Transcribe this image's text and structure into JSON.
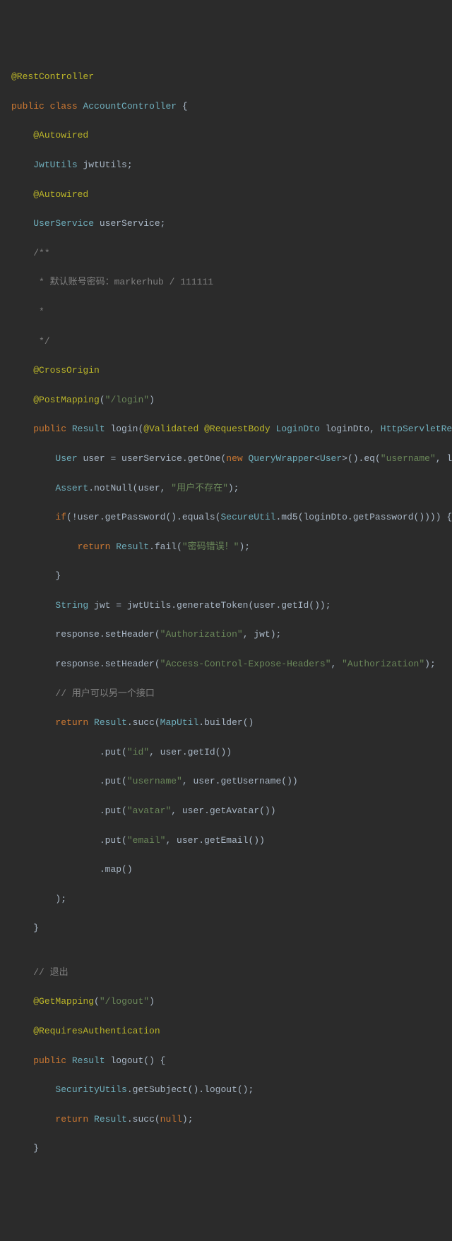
{
  "lines": [
    {
      "indent": 0,
      "tokens": [
        {
          "t": "@RestController",
          "c": "annotation"
        }
      ]
    },
    {
      "indent": 0,
      "tokens": []
    },
    {
      "indent": 0,
      "tokens": [
        {
          "t": "public",
          "c": "keyword"
        },
        {
          "t": " ",
          "c": "plain"
        },
        {
          "t": "class",
          "c": "keyword"
        },
        {
          "t": " ",
          "c": "plain"
        },
        {
          "t": "AccountController",
          "c": "type2"
        },
        {
          "t": " {",
          "c": "punct"
        }
      ]
    },
    {
      "indent": 0,
      "tokens": []
    },
    {
      "indent": 1,
      "tokens": [
        {
          "t": "@Autowired",
          "c": "annotation"
        }
      ]
    },
    {
      "indent": 0,
      "tokens": []
    },
    {
      "indent": 1,
      "tokens": [
        {
          "t": "JwtUtils",
          "c": "type2"
        },
        {
          "t": " jwtUtils;",
          "c": "plain"
        }
      ]
    },
    {
      "indent": 0,
      "tokens": []
    },
    {
      "indent": 1,
      "tokens": [
        {
          "t": "@Autowired",
          "c": "annotation"
        }
      ]
    },
    {
      "indent": 0,
      "tokens": []
    },
    {
      "indent": 1,
      "tokens": [
        {
          "t": "UserService",
          "c": "type2"
        },
        {
          "t": " userService;",
          "c": "plain"
        }
      ]
    },
    {
      "indent": 0,
      "tokens": []
    },
    {
      "indent": 1,
      "tokens": [
        {
          "t": "/**",
          "c": "comment"
        }
      ]
    },
    {
      "indent": 0,
      "tokens": []
    },
    {
      "indent": 1,
      "tokens": [
        {
          "t": " * 默认账号密码：markerhub / 111111",
          "c": "comment"
        }
      ]
    },
    {
      "indent": 0,
      "tokens": []
    },
    {
      "indent": 1,
      "tokens": [
        {
          "t": " *",
          "c": "comment"
        }
      ]
    },
    {
      "indent": 0,
      "tokens": []
    },
    {
      "indent": 1,
      "tokens": [
        {
          "t": " */",
          "c": "comment"
        }
      ]
    },
    {
      "indent": 0,
      "tokens": []
    },
    {
      "indent": 1,
      "tokens": [
        {
          "t": "@CrossOrigin",
          "c": "annotation"
        }
      ]
    },
    {
      "indent": 0,
      "tokens": []
    },
    {
      "indent": 1,
      "tokens": [
        {
          "t": "@PostMapping",
          "c": "annotation"
        },
        {
          "t": "(",
          "c": "punct"
        },
        {
          "t": "\"/login\"",
          "c": "string"
        },
        {
          "t": ")",
          "c": "punct"
        }
      ]
    },
    {
      "indent": 0,
      "tokens": []
    },
    {
      "indent": 1,
      "tokens": [
        {
          "t": "public",
          "c": "keyword"
        },
        {
          "t": " ",
          "c": "plain"
        },
        {
          "t": "Result",
          "c": "type2"
        },
        {
          "t": " login(",
          "c": "plain"
        },
        {
          "t": "@Validated",
          "c": "param-anno"
        },
        {
          "t": " ",
          "c": "plain"
        },
        {
          "t": "@RequestBody",
          "c": "param-anno"
        },
        {
          "t": " ",
          "c": "plain"
        },
        {
          "t": "LoginDto",
          "c": "type2"
        },
        {
          "t": " loginDto, ",
          "c": "plain"
        },
        {
          "t": "HttpServletResponse",
          "c": "type2"
        }
      ]
    },
    {
      "indent": 0,
      "tokens": []
    },
    {
      "indent": 2,
      "tokens": [
        {
          "t": "User",
          "c": "type2"
        },
        {
          "t": " user = userService.getOne(",
          "c": "plain"
        },
        {
          "t": "new",
          "c": "new-kw"
        },
        {
          "t": " ",
          "c": "plain"
        },
        {
          "t": "QueryWrapper",
          "c": "type2"
        },
        {
          "t": "<",
          "c": "punct"
        },
        {
          "t": "User",
          "c": "type2"
        },
        {
          "t": ">().eq(",
          "c": "plain"
        },
        {
          "t": "\"username\"",
          "c": "string"
        },
        {
          "t": ", loginD",
          "c": "plain"
        }
      ]
    },
    {
      "indent": 0,
      "tokens": []
    },
    {
      "indent": 2,
      "tokens": [
        {
          "t": "Assert",
          "c": "type2"
        },
        {
          "t": ".notNull(user, ",
          "c": "plain"
        },
        {
          "t": "\"用户不存在\"",
          "c": "string"
        },
        {
          "t": ");",
          "c": "punct"
        }
      ]
    },
    {
      "indent": 0,
      "tokens": []
    },
    {
      "indent": 2,
      "tokens": [
        {
          "t": "if",
          "c": "keyword"
        },
        {
          "t": "(!user.getPassword().equals(",
          "c": "plain"
        },
        {
          "t": "SecureUtil",
          "c": "type2"
        },
        {
          "t": ".md5(loginDto.getPassword()))) {",
          "c": "plain"
        }
      ]
    },
    {
      "indent": 0,
      "tokens": []
    },
    {
      "indent": 3,
      "tokens": [
        {
          "t": "return",
          "c": "keyword"
        },
        {
          "t": " ",
          "c": "plain"
        },
        {
          "t": "Result",
          "c": "type2"
        },
        {
          "t": ".fail(",
          "c": "plain"
        },
        {
          "t": "\"密码错误！\"",
          "c": "string"
        },
        {
          "t": ");",
          "c": "punct"
        }
      ]
    },
    {
      "indent": 0,
      "tokens": []
    },
    {
      "indent": 2,
      "tokens": [
        {
          "t": "}",
          "c": "punct"
        }
      ]
    },
    {
      "indent": 0,
      "tokens": []
    },
    {
      "indent": 2,
      "tokens": [
        {
          "t": "String",
          "c": "type2"
        },
        {
          "t": " jwt = jwtUtils.generateToken(user.getId());",
          "c": "plain"
        }
      ]
    },
    {
      "indent": 0,
      "tokens": []
    },
    {
      "indent": 2,
      "tokens": [
        {
          "t": "response.setHeader(",
          "c": "plain"
        },
        {
          "t": "\"Authorization\"",
          "c": "string"
        },
        {
          "t": ", jwt);",
          "c": "plain"
        }
      ]
    },
    {
      "indent": 0,
      "tokens": []
    },
    {
      "indent": 2,
      "tokens": [
        {
          "t": "response.setHeader(",
          "c": "plain"
        },
        {
          "t": "\"Access-Control-Expose-Headers\"",
          "c": "string"
        },
        {
          "t": ", ",
          "c": "plain"
        },
        {
          "t": "\"Authorization\"",
          "c": "string"
        },
        {
          "t": ");",
          "c": "punct"
        }
      ]
    },
    {
      "indent": 0,
      "tokens": []
    },
    {
      "indent": 2,
      "tokens": [
        {
          "t": "// 用户可以另一个接口",
          "c": "comment"
        }
      ]
    },
    {
      "indent": 0,
      "tokens": []
    },
    {
      "indent": 2,
      "tokens": [
        {
          "t": "return",
          "c": "keyword"
        },
        {
          "t": " ",
          "c": "plain"
        },
        {
          "t": "Result",
          "c": "type2"
        },
        {
          "t": ".succ(",
          "c": "plain"
        },
        {
          "t": "MapUtil",
          "c": "type2"
        },
        {
          "t": ".builder()",
          "c": "plain"
        }
      ]
    },
    {
      "indent": 0,
      "tokens": []
    },
    {
      "indent": 4,
      "tokens": [
        {
          "t": ".put(",
          "c": "plain"
        },
        {
          "t": "\"id\"",
          "c": "string"
        },
        {
          "t": ", user.getId())",
          "c": "plain"
        }
      ]
    },
    {
      "indent": 0,
      "tokens": []
    },
    {
      "indent": 4,
      "tokens": [
        {
          "t": ".put(",
          "c": "plain"
        },
        {
          "t": "\"username\"",
          "c": "string"
        },
        {
          "t": ", user.getUsername())",
          "c": "plain"
        }
      ]
    },
    {
      "indent": 0,
      "tokens": []
    },
    {
      "indent": 4,
      "tokens": [
        {
          "t": ".put(",
          "c": "plain"
        },
        {
          "t": "\"avatar\"",
          "c": "string"
        },
        {
          "t": ", user.getAvatar())",
          "c": "plain"
        }
      ]
    },
    {
      "indent": 0,
      "tokens": []
    },
    {
      "indent": 4,
      "tokens": [
        {
          "t": ".put(",
          "c": "plain"
        },
        {
          "t": "\"email\"",
          "c": "string"
        },
        {
          "t": ", user.getEmail())",
          "c": "plain"
        }
      ]
    },
    {
      "indent": 0,
      "tokens": []
    },
    {
      "indent": 4,
      "tokens": [
        {
          "t": ".map()",
          "c": "plain"
        }
      ]
    },
    {
      "indent": 0,
      "tokens": []
    },
    {
      "indent": 2,
      "tokens": [
        {
          "t": ");",
          "c": "punct"
        }
      ]
    },
    {
      "indent": 0,
      "tokens": []
    },
    {
      "indent": 1,
      "tokens": [
        {
          "t": "}",
          "c": "punct"
        }
      ]
    },
    {
      "indent": 0,
      "tokens": []
    },
    {
      "indent": 0,
      "tokens": []
    },
    {
      "indent": 1,
      "tokens": [
        {
          "t": "// 退出",
          "c": "comment"
        }
      ]
    },
    {
      "indent": 0,
      "tokens": []
    },
    {
      "indent": 1,
      "tokens": [
        {
          "t": "@GetMapping",
          "c": "annotation"
        },
        {
          "t": "(",
          "c": "punct"
        },
        {
          "t": "\"/logout\"",
          "c": "string"
        },
        {
          "t": ")",
          "c": "punct"
        }
      ]
    },
    {
      "indent": 0,
      "tokens": []
    },
    {
      "indent": 1,
      "tokens": [
        {
          "t": "@RequiresAuthentication",
          "c": "annotation"
        }
      ]
    },
    {
      "indent": 0,
      "tokens": []
    },
    {
      "indent": 1,
      "tokens": [
        {
          "t": "public",
          "c": "keyword"
        },
        {
          "t": " ",
          "c": "plain"
        },
        {
          "t": "Result",
          "c": "type2"
        },
        {
          "t": " logout() {",
          "c": "plain"
        }
      ]
    },
    {
      "indent": 0,
      "tokens": []
    },
    {
      "indent": 2,
      "tokens": [
        {
          "t": "SecurityUtils",
          "c": "type2"
        },
        {
          "t": ".getSubject().logout();",
          "c": "plain"
        }
      ]
    },
    {
      "indent": 0,
      "tokens": []
    },
    {
      "indent": 2,
      "tokens": [
        {
          "t": "return",
          "c": "keyword"
        },
        {
          "t": " ",
          "c": "plain"
        },
        {
          "t": "Result",
          "c": "type2"
        },
        {
          "t": ".succ(",
          "c": "plain"
        },
        {
          "t": "null",
          "c": "null-kw"
        },
        {
          "t": ");",
          "c": "punct"
        }
      ]
    },
    {
      "indent": 0,
      "tokens": []
    },
    {
      "indent": 1,
      "tokens": [
        {
          "t": "}",
          "c": "punct"
        }
      ]
    }
  ]
}
